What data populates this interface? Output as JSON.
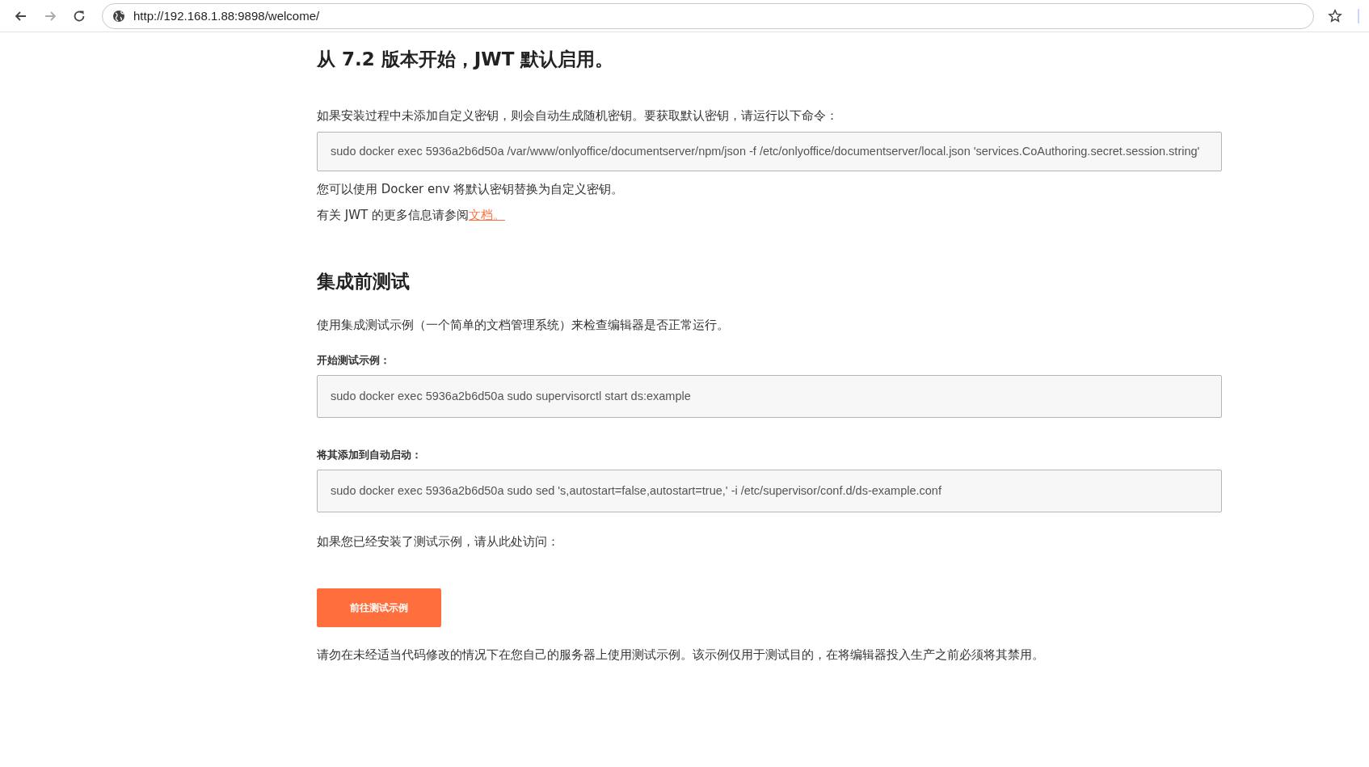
{
  "browser": {
    "url": "http://192.168.1.88:9898/welcome/"
  },
  "sections": [
    {
      "heading": "从 7.2 版本开始，JWT 默认启用。",
      "blocks": [
        {
          "kind": "para",
          "text": "如果安装过程中未添加自定义密钥，则会自动生成随机密钥。要获取默认密钥，请运行以下命令："
        },
        {
          "kind": "code",
          "text": "sudo docker exec 5936a2b6d50a /var/www/onlyoffice/documentserver/npm/json -f /etc/onlyoffice/documentserver/local.json 'services.CoAuthoring.secret.session.string'"
        },
        {
          "kind": "para",
          "text": "您可以使用 Docker env 将默认密钥替换为自定义密钥。"
        },
        {
          "kind": "para",
          "text": "有关 JWT 的更多信息请参阅",
          "link": "文档。"
        }
      ]
    },
    {
      "heading": "集成前测试",
      "blocks": [
        {
          "kind": "para",
          "text": "使用集成测试示例（一个简单的文档管理系统）来检查编辑器是否正常运行。"
        },
        {
          "kind": "label",
          "text": "开始测试示例："
        },
        {
          "kind": "code",
          "text": "sudo docker exec 5936a2b6d50a sudo supervisorctl start ds:example"
        },
        {
          "kind": "label",
          "text": "将其添加到自动启动："
        },
        {
          "kind": "code",
          "text": "sudo docker exec 5936a2b6d50a sudo sed 's,autostart=false,autostart=true,' -i /etc/supervisor/conf.d/ds-example.conf"
        },
        {
          "kind": "para",
          "text": "如果您已经安装了测试示例，请从此处访问："
        },
        {
          "kind": "button",
          "text": "前往测试示例"
        },
        {
          "kind": "para",
          "text": "请勿在未经适当代码修改的情况下在您自己的服务器上使用测试示例。该示例仅用于测试目的，在将编辑器投入生产之前必须将其禁用。"
        }
      ]
    }
  ]
}
